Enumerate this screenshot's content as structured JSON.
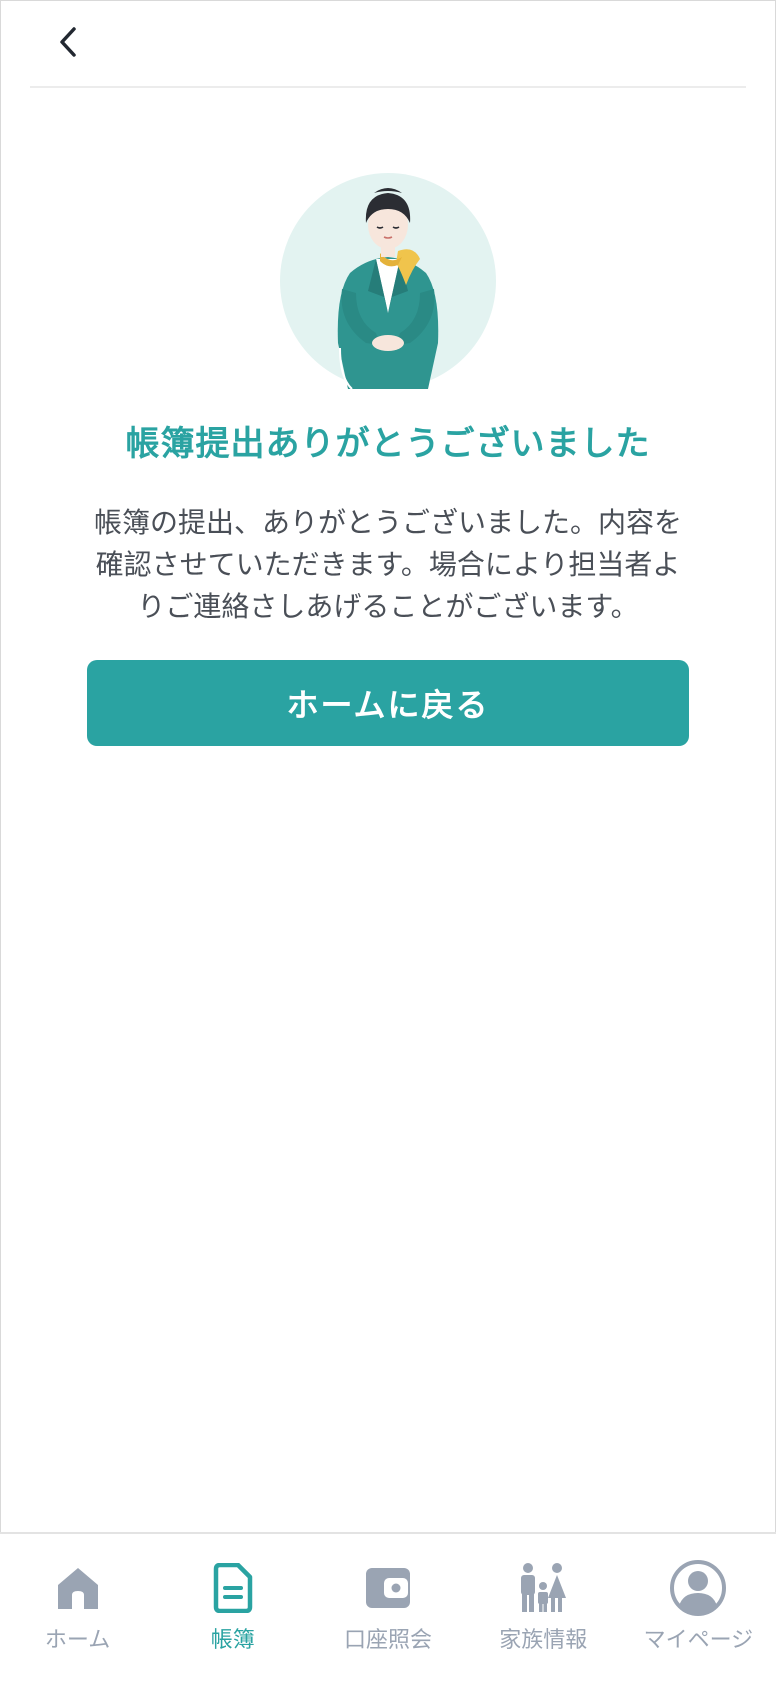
{
  "header": {
    "back_icon": "chevron-left-icon"
  },
  "illustration": {
    "icon": "bowing-staff-illustration"
  },
  "content": {
    "title": "帳簿提出ありがとうございました",
    "message": "帳簿の提出、ありがとうございました。内容を確認させていただきます。場合により担当者よりご連絡さしあげることがございます。",
    "home_button": "ホームに戻る"
  },
  "tabbar": {
    "active_index": 1,
    "items": [
      {
        "label": "ホーム",
        "icon": "home-icon"
      },
      {
        "label": "帳簿",
        "icon": "ledger-document-icon"
      },
      {
        "label": "口座照会",
        "icon": "wallet-icon"
      },
      {
        "label": "家族情報",
        "icon": "family-icon"
      },
      {
        "label": "マイページ",
        "icon": "user-avatar-icon"
      }
    ]
  },
  "colors": {
    "accent": "#2aa3a2",
    "inactive_tab": "#9aa4b3",
    "body_text": "#4a4f57",
    "illustration_bg": "#e3f3f1",
    "scarf": "#f0c44c"
  }
}
